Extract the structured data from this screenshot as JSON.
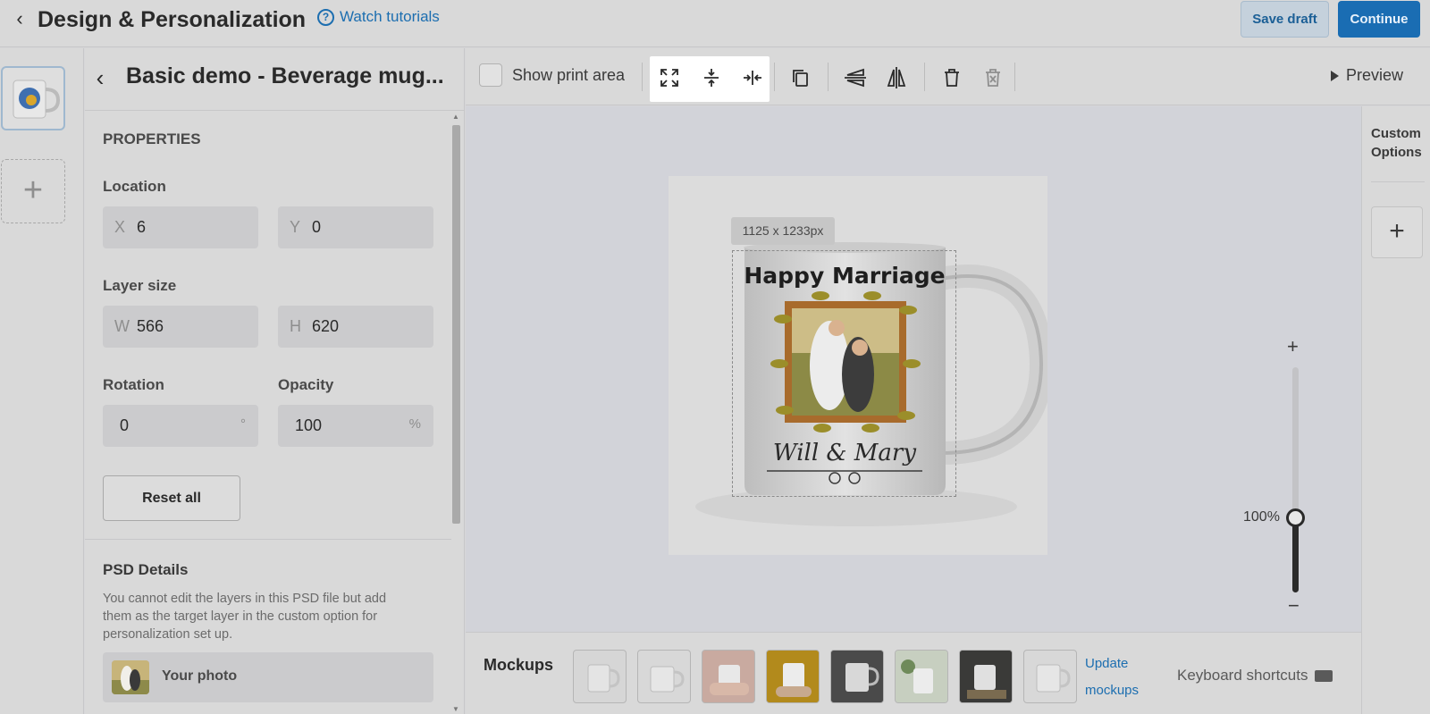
{
  "header": {
    "title": "Design & Personalization",
    "watch_label": "Watch tutorials",
    "save_draft": "Save draft",
    "continue": "Continue"
  },
  "panel": {
    "title": "Basic demo - Beverage mug...",
    "properties_heading": "PROPERTIES",
    "location_label": "Location",
    "x_prefix": "X",
    "x_value": "6",
    "y_prefix": "Y",
    "y_value": "0",
    "layer_size_label": "Layer size",
    "w_prefix": "W",
    "w_value": "566",
    "h_prefix": "H",
    "h_value": "620",
    "rotation_label": "Rotation",
    "rotation_value": "0",
    "rotation_unit": "°",
    "opacity_label": "Opacity",
    "opacity_value": "100",
    "opacity_unit": "%",
    "reset_label": "Reset all",
    "psd_heading": "PSD Details",
    "psd_description": "You cannot edit the layers in this PSD file but add them as the target layer in the custom option for personalization set up.",
    "psd_layer_name": "Your photo"
  },
  "toolbar": {
    "show_print_area": "Show print area",
    "tools": [
      "fit-canvas-icon",
      "fit-height-icon",
      "fit-width-icon",
      "duplicate-icon",
      "flip-vertical-icon",
      "flip-horizontal-icon",
      "delete-icon",
      "delete-all-icon"
    ],
    "preview": "Preview"
  },
  "canvas": {
    "dimension_badge": "1125 x 1233px",
    "mug_text_top": "Happy Marriage",
    "mug_text_bottom": "Will & Mary",
    "zoom_plus": "+",
    "zoom_minus": "−",
    "zoom_value": "100%",
    "zoom_fraction": 0.35
  },
  "right": {
    "custom_options": "Custom Options",
    "add": "+"
  },
  "bottom": {
    "mockups_label": "Mockups",
    "update_mockups": "Update mockups",
    "keyboard_shortcuts": "Keyboard shortcuts"
  },
  "colors": {
    "accent": "#1a6db3",
    "highlight": "#ffffff"
  }
}
